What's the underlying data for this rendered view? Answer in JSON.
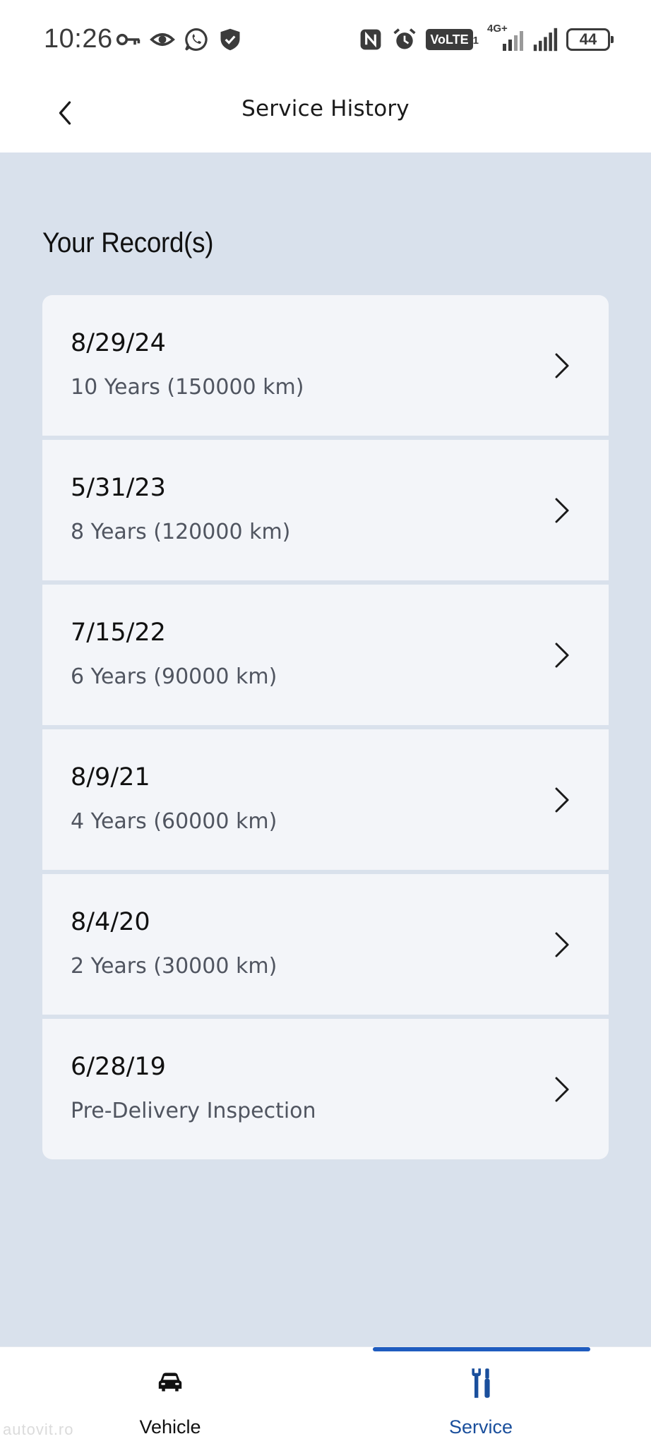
{
  "status_bar": {
    "time": "10:26",
    "left_icons": [
      "key-icon",
      "eye-icon",
      "whatsapp-icon",
      "shield-icon"
    ],
    "right_icons": [
      "nfc-icon",
      "alarm-icon",
      "volte-icon",
      "4g-signal-icon",
      "signal-icon",
      "battery-icon"
    ],
    "volte_label": "VoLTE",
    "volte_sub": "1",
    "network_label": "4G+",
    "battery_level": "44"
  },
  "header": {
    "title": "Service History",
    "back_icon": "chevron-left-icon"
  },
  "section": {
    "title": "Your Record(s)"
  },
  "records": [
    {
      "date": "8/29/24",
      "description": "10 Years (150000 km)"
    },
    {
      "date": "5/31/23",
      "description": "8 Years (120000 km)"
    },
    {
      "date": "7/15/22",
      "description": "6 Years (90000 km)"
    },
    {
      "date": "8/9/21",
      "description": "4 Years (60000 km)"
    },
    {
      "date": "8/4/20",
      "description": "2 Years (30000 km)"
    },
    {
      "date": "6/28/19",
      "description": "Pre-Delivery Inspection"
    }
  ],
  "bottom_nav": {
    "tabs": [
      {
        "label": "Vehicle",
        "icon": "car-icon",
        "active": false
      },
      {
        "label": "Service",
        "icon": "wrench-screwdriver-icon",
        "active": true
      }
    ],
    "active_color": "#1f5cbf"
  },
  "watermark": "autovit.ro"
}
